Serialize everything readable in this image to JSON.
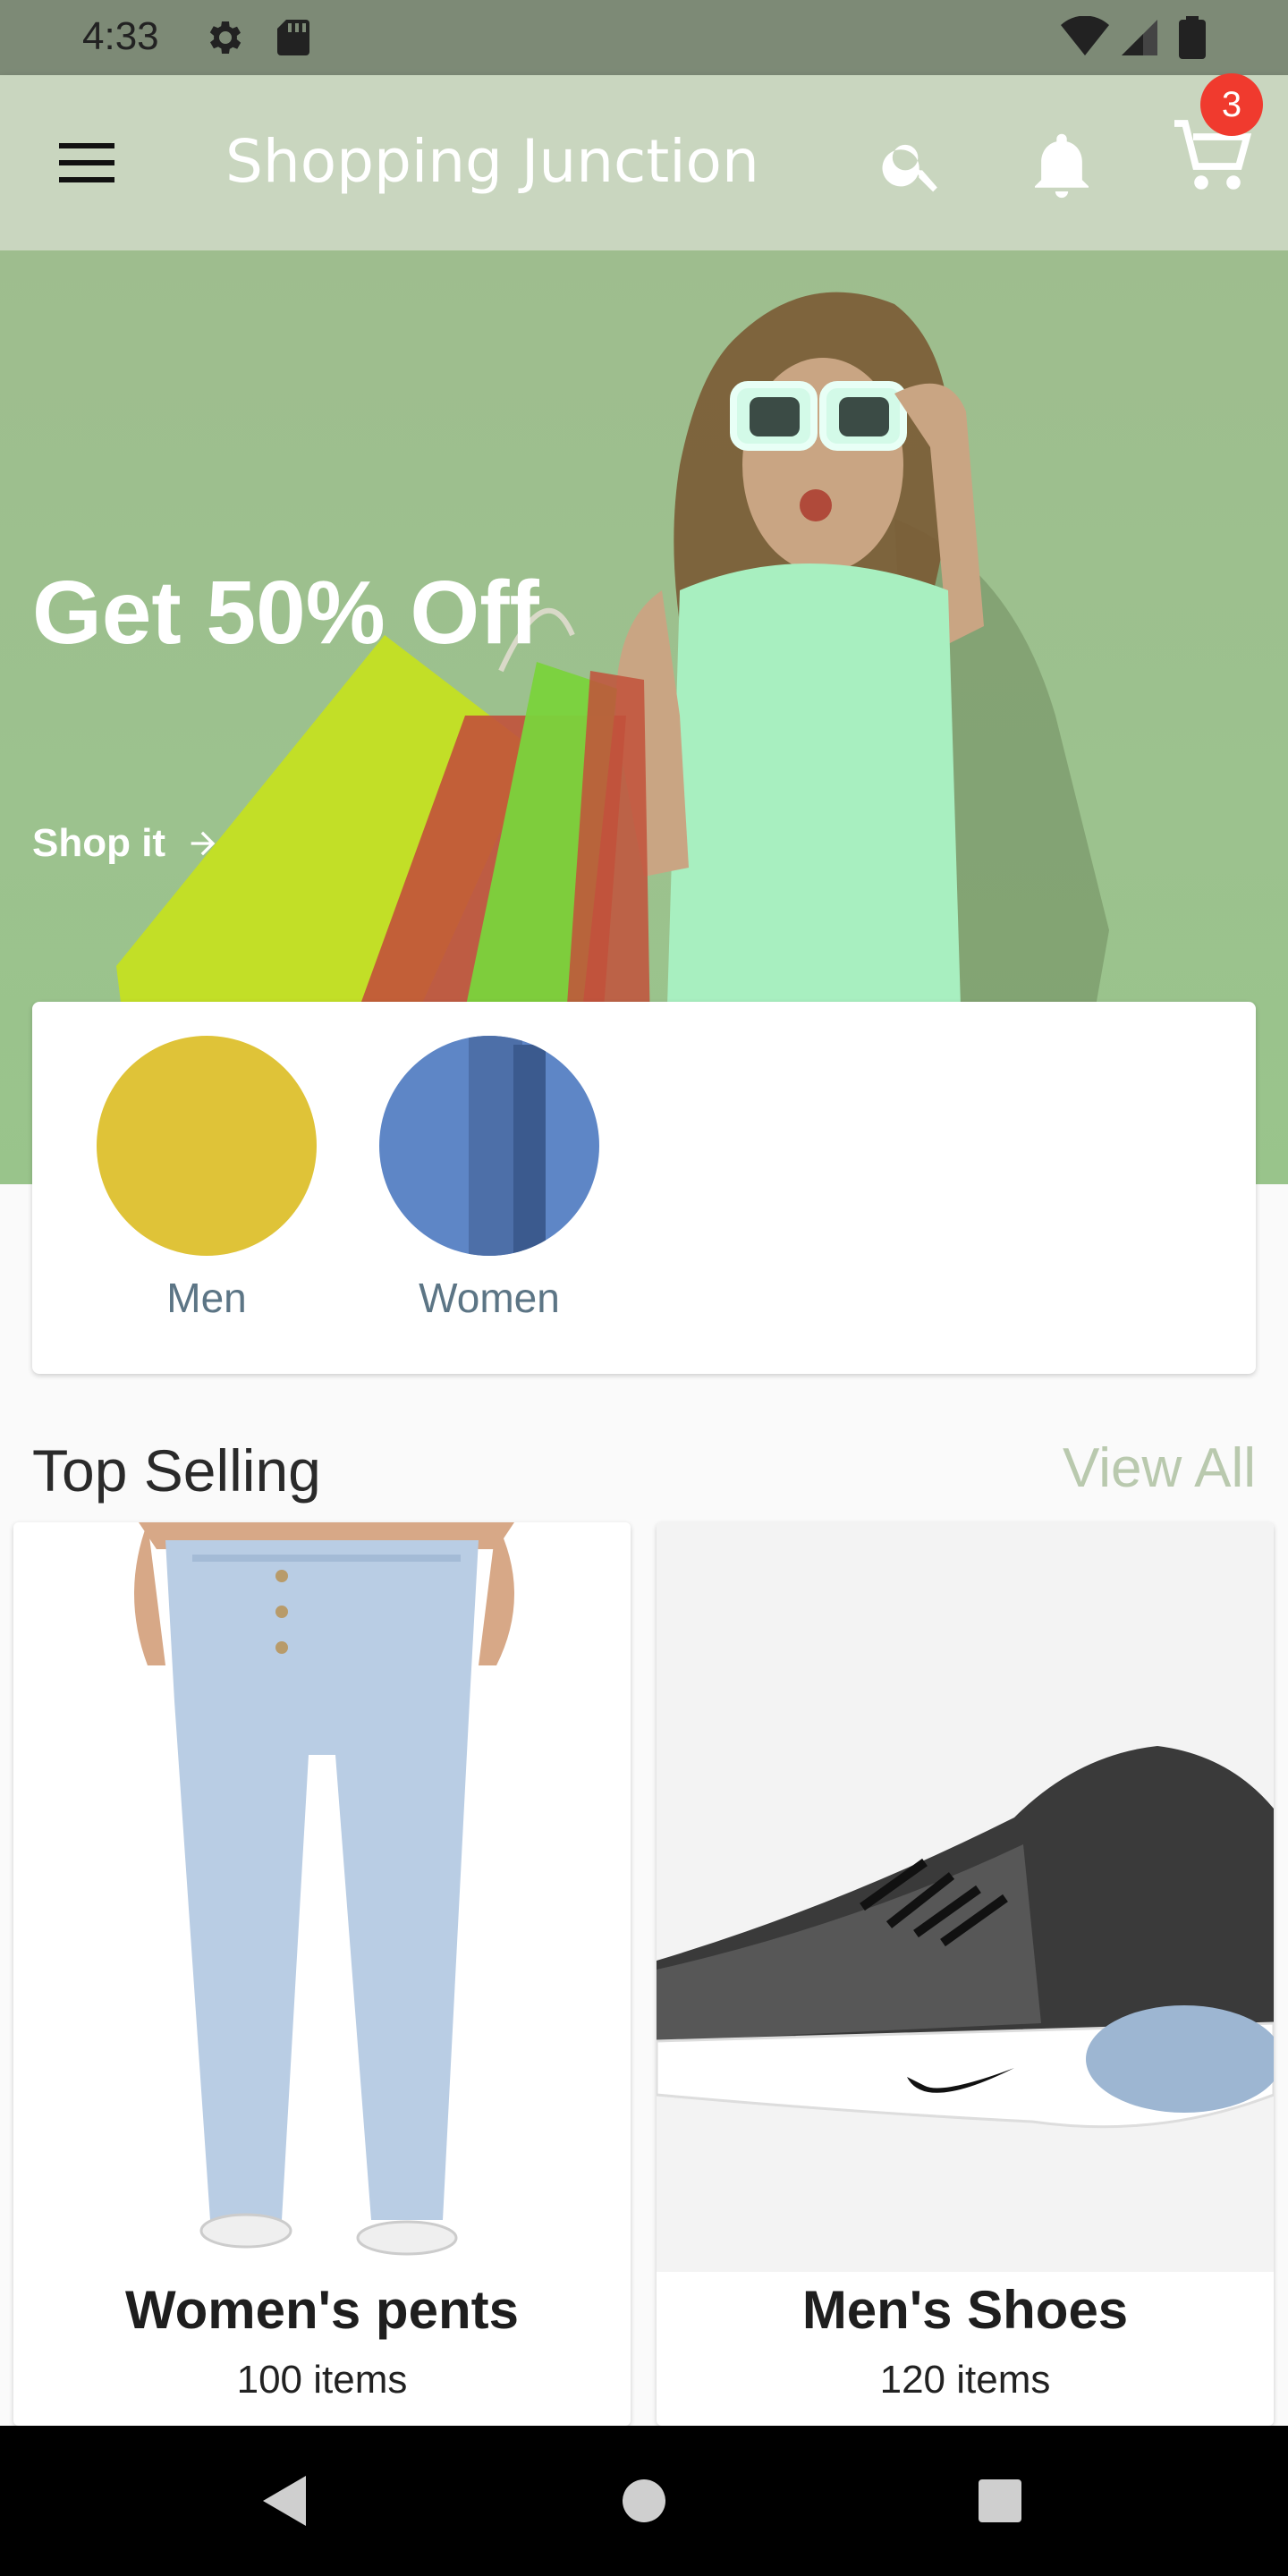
{
  "status_bar": {
    "time": "4:33"
  },
  "app_bar": {
    "title": "Shopping Junction",
    "cart_count": "3"
  },
  "hero": {
    "headline": "Get 50% Off",
    "cta_label": "Shop it"
  },
  "categories": [
    {
      "label": "Men",
      "color": "#dfc338"
    },
    {
      "label": "Women",
      "color": "#5e86c6"
    }
  ],
  "top_selling": {
    "title": "Top Selling",
    "view_all": "View All",
    "products": [
      {
        "name": "Women's pents",
        "count": "100 items"
      },
      {
        "name": "Men's Shoes",
        "count": "120 items"
      }
    ]
  },
  "colors": {
    "accent": "#c9d6bf",
    "badge": "#f03a2e",
    "label": "#5c7585"
  }
}
